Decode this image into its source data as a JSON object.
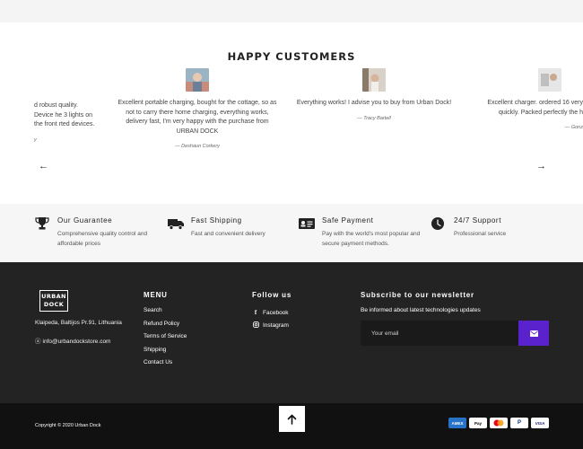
{
  "testimonials": {
    "title": "HAPPY CUSTOMERS",
    "reviews": [
      {
        "text": "d robust quality. Device he 3 lights on the front rted devices.",
        "author": "y"
      },
      {
        "text": "Excellent portable charging, bought for the cottage, so as not to carry there home charging, everything works, delivery fast, I'm very happy with the purchase from URBAN DOCK",
        "author": "— Deshaun Corkery"
      },
      {
        "text": "Everything works! I advise you to buy from Urban Dock!",
        "author": "— Tracy Bartell"
      },
      {
        "text": "Excellent charger. ordered 16 very quickly. Packed perfectly the h",
        "author": "— Gonz"
      }
    ],
    "prev_arrow": "←",
    "next_arrow": "→"
  },
  "features": [
    {
      "title": "Our Guarantee",
      "desc": "Comprehensive quality control and affordable prices",
      "icon": "trophy-icon"
    },
    {
      "title": "Fast Shipping",
      "desc": "Fast and convenient delivery",
      "icon": "truck-icon"
    },
    {
      "title": "Safe Payment",
      "desc": "Pay with the world's most popular and secure payment methods.",
      "icon": "id-card-icon"
    },
    {
      "title": "24/7 Support",
      "desc": "Professional service",
      "icon": "clock-icon"
    }
  ],
  "footer": {
    "logo_line1": "URBAN",
    "logo_line2": "DOCK",
    "address": "Klaipeda, Baltijos Pr.91, Lithuania",
    "email": "info@urbandockstore.com",
    "menu_title": "MENU",
    "menu": [
      "Search",
      "Refund Policy",
      "Terms of Service",
      "Shipping",
      "Contact Us"
    ],
    "follow_title": "Follow us",
    "social": [
      "Facebook",
      "Instagram"
    ],
    "newsletter_title": "Subscribe to our newsletter",
    "newsletter_sub": "Be informed about latest technologies updates",
    "email_placeholder": "Your email",
    "copyright": "Copyright © 2020 Urban Dock",
    "payments": [
      "AMEX",
      "Pay",
      "MC",
      "P",
      "VISA"
    ]
  },
  "colors": {
    "accent": "#5a22cc",
    "footer_bg": "#232323",
    "bottom_bg": "#111111"
  }
}
